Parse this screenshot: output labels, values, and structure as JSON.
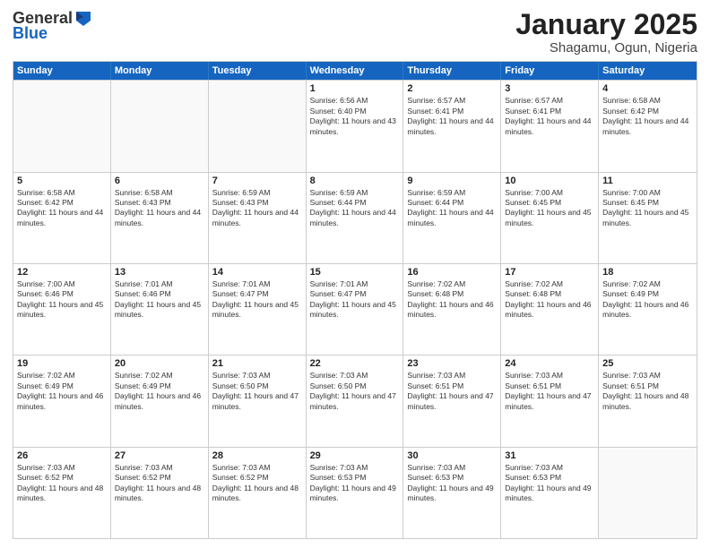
{
  "logo": {
    "general": "General",
    "blue": "Blue"
  },
  "header": {
    "month": "January 2025",
    "location": "Shagamu, Ogun, Nigeria"
  },
  "weekdays": [
    "Sunday",
    "Monday",
    "Tuesday",
    "Wednesday",
    "Thursday",
    "Friday",
    "Saturday"
  ],
  "rows": [
    [
      {
        "day": "",
        "info": ""
      },
      {
        "day": "",
        "info": ""
      },
      {
        "day": "",
        "info": ""
      },
      {
        "day": "1",
        "info": "Sunrise: 6:56 AM\nSunset: 6:40 PM\nDaylight: 11 hours and 43 minutes."
      },
      {
        "day": "2",
        "info": "Sunrise: 6:57 AM\nSunset: 6:41 PM\nDaylight: 11 hours and 44 minutes."
      },
      {
        "day": "3",
        "info": "Sunrise: 6:57 AM\nSunset: 6:41 PM\nDaylight: 11 hours and 44 minutes."
      },
      {
        "day": "4",
        "info": "Sunrise: 6:58 AM\nSunset: 6:42 PM\nDaylight: 11 hours and 44 minutes."
      }
    ],
    [
      {
        "day": "5",
        "info": "Sunrise: 6:58 AM\nSunset: 6:42 PM\nDaylight: 11 hours and 44 minutes."
      },
      {
        "day": "6",
        "info": "Sunrise: 6:58 AM\nSunset: 6:43 PM\nDaylight: 11 hours and 44 minutes."
      },
      {
        "day": "7",
        "info": "Sunrise: 6:59 AM\nSunset: 6:43 PM\nDaylight: 11 hours and 44 minutes."
      },
      {
        "day": "8",
        "info": "Sunrise: 6:59 AM\nSunset: 6:44 PM\nDaylight: 11 hours and 44 minutes."
      },
      {
        "day": "9",
        "info": "Sunrise: 6:59 AM\nSunset: 6:44 PM\nDaylight: 11 hours and 44 minutes."
      },
      {
        "day": "10",
        "info": "Sunrise: 7:00 AM\nSunset: 6:45 PM\nDaylight: 11 hours and 45 minutes."
      },
      {
        "day": "11",
        "info": "Sunrise: 7:00 AM\nSunset: 6:45 PM\nDaylight: 11 hours and 45 minutes."
      }
    ],
    [
      {
        "day": "12",
        "info": "Sunrise: 7:00 AM\nSunset: 6:46 PM\nDaylight: 11 hours and 45 minutes."
      },
      {
        "day": "13",
        "info": "Sunrise: 7:01 AM\nSunset: 6:46 PM\nDaylight: 11 hours and 45 minutes."
      },
      {
        "day": "14",
        "info": "Sunrise: 7:01 AM\nSunset: 6:47 PM\nDaylight: 11 hours and 45 minutes."
      },
      {
        "day": "15",
        "info": "Sunrise: 7:01 AM\nSunset: 6:47 PM\nDaylight: 11 hours and 45 minutes."
      },
      {
        "day": "16",
        "info": "Sunrise: 7:02 AM\nSunset: 6:48 PM\nDaylight: 11 hours and 46 minutes."
      },
      {
        "day": "17",
        "info": "Sunrise: 7:02 AM\nSunset: 6:48 PM\nDaylight: 11 hours and 46 minutes."
      },
      {
        "day": "18",
        "info": "Sunrise: 7:02 AM\nSunset: 6:49 PM\nDaylight: 11 hours and 46 minutes."
      }
    ],
    [
      {
        "day": "19",
        "info": "Sunrise: 7:02 AM\nSunset: 6:49 PM\nDaylight: 11 hours and 46 minutes."
      },
      {
        "day": "20",
        "info": "Sunrise: 7:02 AM\nSunset: 6:49 PM\nDaylight: 11 hours and 46 minutes."
      },
      {
        "day": "21",
        "info": "Sunrise: 7:03 AM\nSunset: 6:50 PM\nDaylight: 11 hours and 47 minutes."
      },
      {
        "day": "22",
        "info": "Sunrise: 7:03 AM\nSunset: 6:50 PM\nDaylight: 11 hours and 47 minutes."
      },
      {
        "day": "23",
        "info": "Sunrise: 7:03 AM\nSunset: 6:51 PM\nDaylight: 11 hours and 47 minutes."
      },
      {
        "day": "24",
        "info": "Sunrise: 7:03 AM\nSunset: 6:51 PM\nDaylight: 11 hours and 47 minutes."
      },
      {
        "day": "25",
        "info": "Sunrise: 7:03 AM\nSunset: 6:51 PM\nDaylight: 11 hours and 48 minutes."
      }
    ],
    [
      {
        "day": "26",
        "info": "Sunrise: 7:03 AM\nSunset: 6:52 PM\nDaylight: 11 hours and 48 minutes."
      },
      {
        "day": "27",
        "info": "Sunrise: 7:03 AM\nSunset: 6:52 PM\nDaylight: 11 hours and 48 minutes."
      },
      {
        "day": "28",
        "info": "Sunrise: 7:03 AM\nSunset: 6:52 PM\nDaylight: 11 hours and 48 minutes."
      },
      {
        "day": "29",
        "info": "Sunrise: 7:03 AM\nSunset: 6:53 PM\nDaylight: 11 hours and 49 minutes."
      },
      {
        "day": "30",
        "info": "Sunrise: 7:03 AM\nSunset: 6:53 PM\nDaylight: 11 hours and 49 minutes."
      },
      {
        "day": "31",
        "info": "Sunrise: 7:03 AM\nSunset: 6:53 PM\nDaylight: 11 hours and 49 minutes."
      },
      {
        "day": "",
        "info": ""
      }
    ]
  ]
}
